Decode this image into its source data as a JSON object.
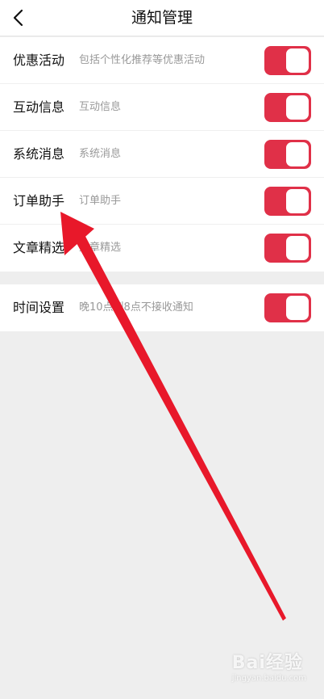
{
  "header": {
    "title": "通知管理",
    "back_icon": "chevron-left-icon"
  },
  "settings": [
    {
      "label": "优惠活动",
      "desc": "包括个性化推荐等优惠活动",
      "enabled": true
    },
    {
      "label": "互动信息",
      "desc": "互动信息",
      "enabled": true
    },
    {
      "label": "系统消息",
      "desc": "系统消息",
      "enabled": true
    },
    {
      "label": "订单助手",
      "desc": "订单助手",
      "enabled": true
    },
    {
      "label": "文章精选",
      "desc": "文章精选",
      "enabled": true
    }
  ],
  "time_setting": {
    "label": "时间设置",
    "desc": "晚10点到8点不接收通知",
    "enabled": true
  },
  "colors": {
    "toggle_on": "#e03048",
    "arrow": "#e8182a",
    "background": "#eeeeee"
  },
  "watermark": {
    "text": "Bai经验",
    "sub": "jingyan.baidu.com"
  }
}
